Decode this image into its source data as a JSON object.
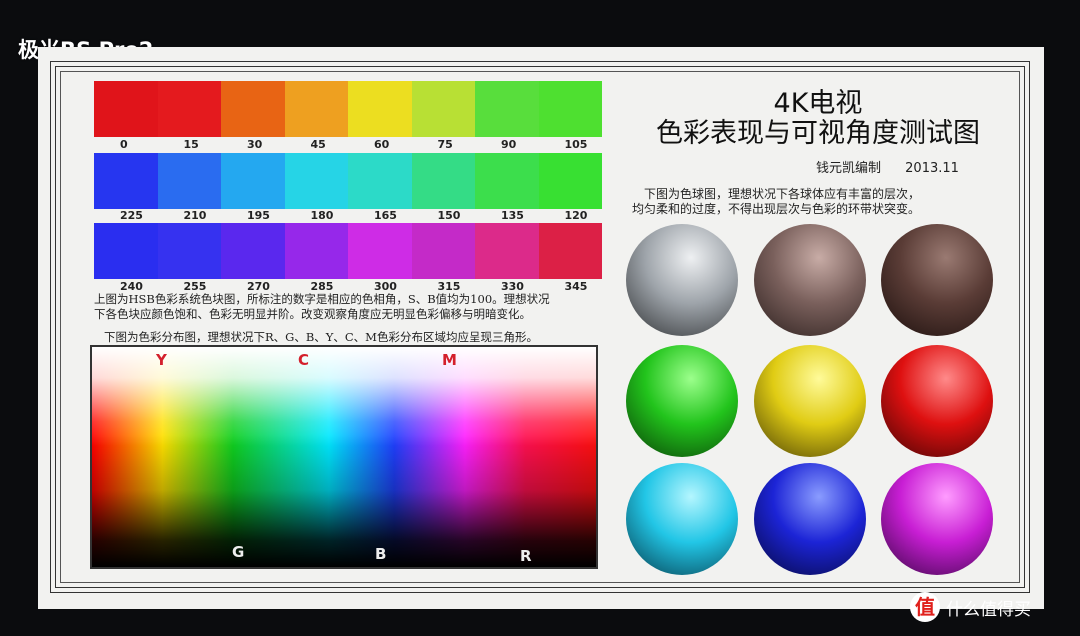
{
  "photo_label": "极米RS Pro2",
  "hue_rows": [
    {
      "labels": [
        "0",
        "15",
        "30",
        "45",
        "60",
        "75",
        "90",
        "105"
      ],
      "colors": [
        "#e0141a",
        "#e41a1e",
        "#e86414",
        "#eea020",
        "#ecde20",
        "#b8e034",
        "#58de3c",
        "#4ee030"
      ]
    },
    {
      "labels": [
        "225",
        "210",
        "195",
        "180",
        "165",
        "150",
        "135",
        "120"
      ],
      "colors": [
        "#2636f0",
        "#2a6cf0",
        "#24a8f0",
        "#26d4e6",
        "#2cdac8",
        "#34dc86",
        "#3cde4c",
        "#38e032"
      ]
    },
    {
      "labels": [
        "240",
        "255",
        "270",
        "285",
        "300",
        "315",
        "330",
        "345"
      ],
      "colors": [
        "#2a2ef0",
        "#3632f0",
        "#5a28ee",
        "#9628ea",
        "#ce2ce6",
        "#c42ac8",
        "#dc2a8a",
        "#dc2046"
      ]
    }
  ],
  "hsb_desc_line1": "上图为HSB色彩系统色块图，所标注的数字是相应的色相角，S、B值均为100。理想状况",
  "hsb_desc_line2": "下各色块应颜色饱和、色彩无明显并阶。改变观察角度应无明显色彩偏移与明暗变化。",
  "gamut_desc": "下图为色彩分布图，理想状况下R、G、B、Y、C、M色彩分布区域均应呈现三角形。",
  "gamut_letters_top": [
    "Y",
    "C",
    "M"
  ],
  "gamut_letters_bottom": [
    "G",
    "B",
    "R"
  ],
  "title_line1": "4K电视",
  "title_line2": "色彩表现与可视角度测试图",
  "author": "钱元凯编制",
  "date": "2013.11",
  "sphere_desc_line1": "下图为色球图，理想状况下各球体应有丰富的层次，",
  "sphere_desc_line2": "均匀柔和的过度，不得出现层次与色彩的环带状突变。",
  "spheres": [
    {
      "light": "#eef0f2",
      "mid": "#9ea4aa",
      "dark": "#2c2e30"
    },
    {
      "light": "#c8aca6",
      "mid": "#7a605c",
      "dark": "#2a1e1c"
    },
    {
      "light": "#9a7a72",
      "mid": "#5a3c36",
      "dark": "#1a0e0c"
    },
    {
      "light": "#9cff8c",
      "mid": "#22c41c",
      "dark": "#083a06"
    },
    {
      "light": "#fffb9a",
      "mid": "#e0cc14",
      "dark": "#463c04"
    },
    {
      "light": "#ff8a8a",
      "mid": "#de1010",
      "dark": "#3e0404"
    },
    {
      "light": "#b4f6ff",
      "mid": "#22c6e6",
      "dark": "#053848"
    },
    {
      "light": "#8a9cff",
      "mid": "#1c24d6",
      "dark": "#05073c"
    },
    {
      "light": "#ff9cff",
      "mid": "#c81ed4",
      "dark": "#360542"
    }
  ],
  "watermark": "什么值得买",
  "watermark_icon": "值"
}
